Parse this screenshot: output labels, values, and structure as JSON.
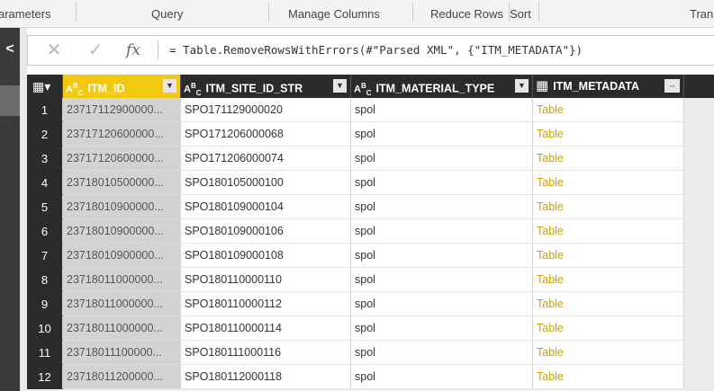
{
  "ribbon": {
    "groups": [
      "arameters",
      "Query",
      "Manage Columns",
      "Reduce Rows",
      "Sort",
      "Tran"
    ]
  },
  "formula_bar": {
    "cancel_glyph": "✕",
    "commit_glyph": "✓",
    "fx_label": "fx",
    "formula": "= Table.RemoveRowsWithErrors(#\"Parsed XML\", {\"ITM_METADATA\"})"
  },
  "table": {
    "columns": [
      {
        "type": "ABC",
        "name": "ITM_ID"
      },
      {
        "type": "ABC",
        "name": "ITM_SITE_ID_STR"
      },
      {
        "type": "ABC",
        "name": "ITM_MATERIAL_TYPE"
      },
      {
        "type": "table",
        "name": "ITM_METADATA"
      }
    ],
    "rows": [
      {
        "n": "1",
        "id": "23717112900000...",
        "site": "SPO171129000020",
        "mat": "spol",
        "meta": "Table"
      },
      {
        "n": "2",
        "id": "23717120600000...",
        "site": "SPO171206000068",
        "mat": "spol",
        "meta": "Table"
      },
      {
        "n": "3",
        "id": "23717120600000...",
        "site": "SPO171206000074",
        "mat": "spol",
        "meta": "Table"
      },
      {
        "n": "4",
        "id": "23718010500000...",
        "site": "SPO180105000100",
        "mat": "spol",
        "meta": "Table"
      },
      {
        "n": "5",
        "id": "23718010900000...",
        "site": "SPO180109000104",
        "mat": "spol",
        "meta": "Table"
      },
      {
        "n": "6",
        "id": "23718010900000...",
        "site": "SPO180109000106",
        "mat": "spol",
        "meta": "Table"
      },
      {
        "n": "7",
        "id": "23718010900000...",
        "site": "SPO180109000108",
        "mat": "spol",
        "meta": "Table"
      },
      {
        "n": "8",
        "id": "23718011000000...",
        "site": "SPO180110000110",
        "mat": "spol",
        "meta": "Table"
      },
      {
        "n": "9",
        "id": "23718011000000...",
        "site": "SPO180110000112",
        "mat": "spol",
        "meta": "Table"
      },
      {
        "n": "10",
        "id": "23718011000000...",
        "site": "SPO180110000114",
        "mat": "spol",
        "meta": "Table"
      },
      {
        "n": "11",
        "id": "23718011100000...",
        "site": "SPO180111000116",
        "mat": "spol",
        "meta": "Table"
      },
      {
        "n": "12",
        "id": "23718011200000...",
        "site": "SPO180112000118",
        "mat": "spol",
        "meta": "Table"
      }
    ]
  },
  "colors": {
    "accent": "#f2c811",
    "header_bg": "#2b2b2b",
    "table_link": "#c9a200"
  }
}
